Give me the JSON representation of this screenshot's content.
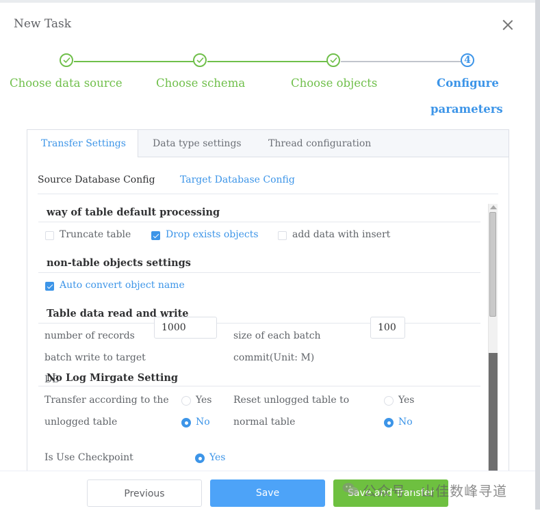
{
  "dialog": {
    "title": "New Task"
  },
  "steps": [
    {
      "label": "Choose data source",
      "state": "done"
    },
    {
      "label": "Choose schema",
      "state": "done"
    },
    {
      "label": "Choose objects",
      "state": "done"
    },
    {
      "number": "4",
      "label_line1": "Configure",
      "label_line2": "parameters",
      "state": "active"
    }
  ],
  "tabs": [
    "Transfer Settings",
    "Data type settings",
    "Thread configuration"
  ],
  "subtabs": [
    "Source Database Config",
    "Target Database Config"
  ],
  "sections": {
    "table_processing": {
      "title": "way of table default processing",
      "options": [
        {
          "label": "Truncate table",
          "checked": false
        },
        {
          "label": "Drop exists objects",
          "checked": true
        },
        {
          "label": "add data with insert",
          "checked": false
        }
      ]
    },
    "non_table": {
      "title": "non-table objects settings",
      "option": {
        "label": "Auto convert object name",
        "checked": true
      }
    },
    "read_write": {
      "title": "Table data read and write",
      "records_label_1": "number of records",
      "records_label_2": "batch write to target",
      "records_label_3": "DB",
      "records_value": "1000",
      "batch_label_1": "size of each batch",
      "batch_label_2": "commit(Unit: M)",
      "batch_value": "100"
    },
    "no_log": {
      "title": "No Log Mirgate Setting",
      "transfer_label_1": "Transfer according to the",
      "transfer_label_2": "unlogged table",
      "reset_label_1": "Reset unlogged table to",
      "reset_label_2": "normal table",
      "yes": "Yes",
      "no": "No",
      "transfer_selected": "No",
      "reset_selected": "No"
    },
    "checkpoint": {
      "label": "Is Use Checkpoint",
      "value": "Yes"
    }
  },
  "footer": {
    "previous": "Previous",
    "save": "Save",
    "save_transfer": "Save and Transfer"
  },
  "watermark": "公众号 · 山佳数峰寻道",
  "colors": {
    "primary": "#3d95e8",
    "success": "#6fbf4a",
    "save_button": "#4da3f8",
    "transfer_button": "#6ec040"
  }
}
